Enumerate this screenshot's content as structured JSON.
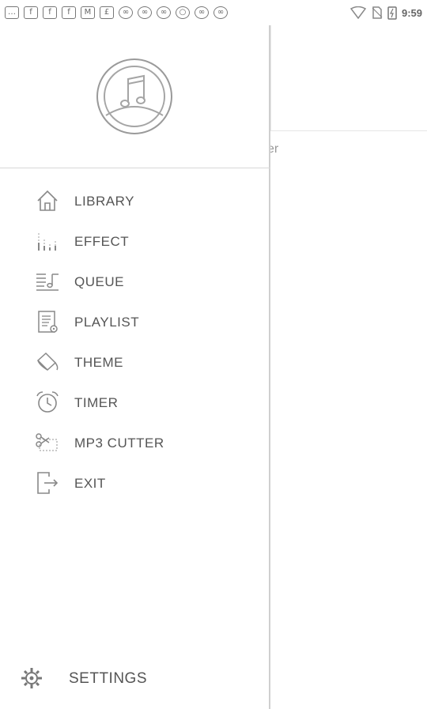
{
  "status_bar": {
    "left_icons": [
      "more-icon",
      "facebook-icon",
      "facebook-icon",
      "facebook-icon",
      "mail-icon",
      "app-icon",
      "app-icon",
      "app-icon",
      "app-icon",
      "app-icon",
      "app-icon",
      "app-icon"
    ],
    "time": "9:59"
  },
  "main": {
    "tab_fragment": "er"
  },
  "drawer": {
    "menu": [
      {
        "label": "LIBRARY",
        "icon": "home-icon"
      },
      {
        "label": "EFFECT",
        "icon": "equalizer-icon"
      },
      {
        "label": "QUEUE",
        "icon": "queue-icon"
      },
      {
        "label": "PLAYLIST",
        "icon": "playlist-icon"
      },
      {
        "label": "THEME",
        "icon": "paint-bucket-icon"
      },
      {
        "label": "TIMER",
        "icon": "alarm-clock-icon"
      },
      {
        "label": "MP3 CUTTER",
        "icon": "scissors-icon"
      },
      {
        "label": "EXIT",
        "icon": "exit-icon"
      }
    ],
    "settings_label": "SETTINGS"
  }
}
